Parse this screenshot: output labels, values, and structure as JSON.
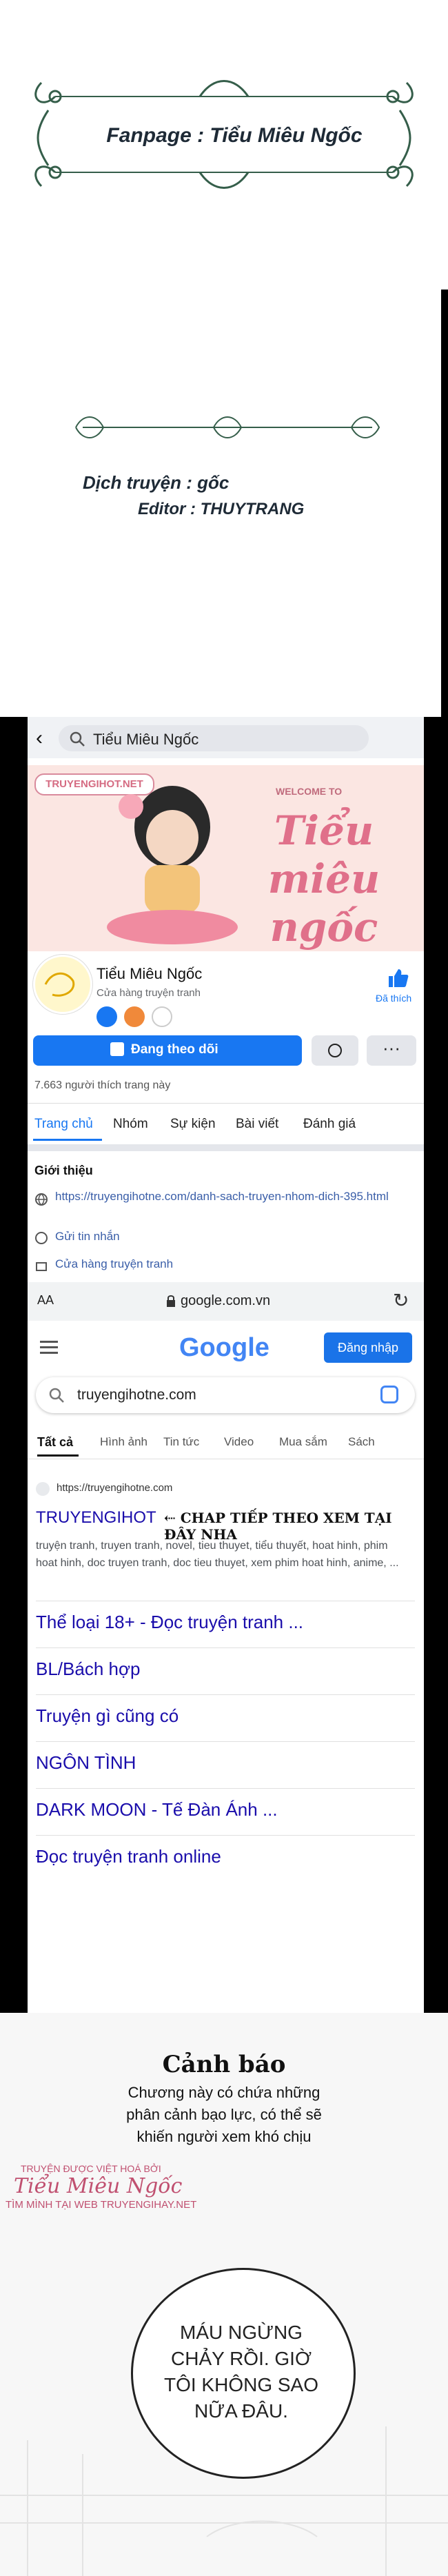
{
  "credits": {
    "fanpage": "Fanpage : Tiểu Miêu Ngốc",
    "translator": "Dịch truyện : gốc",
    "editor": "Editor : THUYTRANG"
  },
  "facebook": {
    "search_value": "Tiểu Miêu Ngốc",
    "banner_site": "TRUYENGIHOT.NET",
    "banner_welcome": "WELCOME TO",
    "banner_script": "Tiểu miêu ngốc",
    "page_name": "Tiểu Miêu Ngốc",
    "page_category": "Cửa hàng truyện tranh",
    "like_label": "Đã thích",
    "following_button": "Đang theo dõi",
    "likes_count": "7.663 người thích trang này",
    "tabs": [
      "Trang chủ",
      "Nhóm",
      "Sự kiện",
      "Bài viết",
      "Đánh giá"
    ],
    "intro_heading": "Giới thiệu",
    "intro_link": "https://truyengihotne.com/danh-sach-truyen-nhom-dich-395.html",
    "send_message": "Gửi tin nhắn",
    "store_label": "Cửa hàng truyện tranh",
    "url_bar_aa": "AA",
    "url_bar_domain": "google.com.vn"
  },
  "google": {
    "logo": "Google",
    "sign_in": "Đăng nhập",
    "query": "truyengihotne.com",
    "tabs": [
      "Tất cả",
      "Hình ảnh",
      "Tin tức",
      "Video",
      "Mua sắm",
      "Sách"
    ],
    "result_url": "https://truyengihotne.com",
    "result_title": "TRUYENGIHOT",
    "result_note": "⇠ CHAP TIẾP THEO XEM TẠI ĐÂY NHA",
    "result_snippet": "truyện tranh, truyen tranh, novel, tieu thuyet, tiểu thuyết, hoat hinh, phim hoat hinh, doc truyen tranh, doc tieu thuyet, xem phim hoat hinh, anime, ...",
    "sitelinks": [
      "Thể loại 18+ - Đọc truyện tranh ...",
      "BL/Bách hợp",
      "Truyện gì cũng có",
      "NGÔN TÌNH",
      "DARK MOON - Tế Đàn Ánh ...",
      "Đọc truyện tranh online"
    ]
  },
  "comic": {
    "warning_title": "Cảnh báo",
    "warning_lines": [
      "Chương này có chứa những",
      "phân cảnh bạo lực, có thể sẽ",
      "khiến người xem khó chịu"
    ],
    "watermark_top": "TRUYỆN ĐƯỢC VIỆT HOÁ BỞI",
    "watermark_name": "Tiểu Miêu Ngốc",
    "watermark_bottom": "TÌM MÌNH TẠI WEB TRUYENGIHAY.NET",
    "bubble_lines": [
      "MÁU NGỪNG",
      "CHẢY RỒI. GIỜ",
      "TÔI KHÔNG SAO",
      "NỮA ĐÂU."
    ]
  },
  "colors": {
    "fb_blue": "#1877f2",
    "google_blue": "#1a73e8",
    "link_purple": "#1a0dab",
    "frame_green": "#355e4a"
  }
}
